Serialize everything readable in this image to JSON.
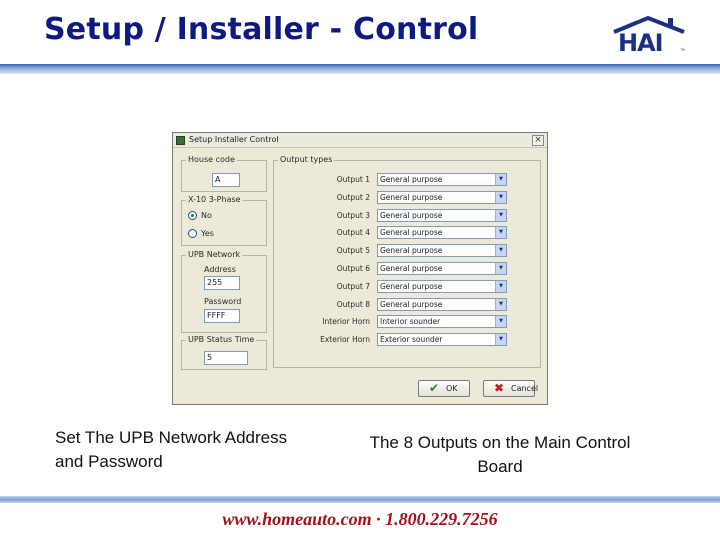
{
  "slide": {
    "title": "Setup / Installer - Control",
    "logo_text": "HAI",
    "logo_tm": "™",
    "caption_left": "Set The UPB Network Address and Password",
    "caption_right": "The 8 Outputs on the Main Control Board",
    "footer": "www.homeauto.com · 1.800.229.7256"
  },
  "dialog": {
    "title": "Setup Installer Control",
    "close_glyph": "×",
    "house_code": {
      "label": "House code",
      "value": "A"
    },
    "x10_phase": {
      "label": "X-10 3-Phase",
      "options": [
        {
          "label": "No",
          "selected": true
        },
        {
          "label": "Yes",
          "selected": false
        }
      ]
    },
    "upb_network": {
      "label": "UPB Network",
      "address_label": "Address",
      "address_value": "255",
      "password_label": "Password",
      "password_value": "FFFF"
    },
    "upb_status_time": {
      "label": "UPB Status Time",
      "value": "5"
    },
    "output_types": {
      "label": "Output types",
      "rows": [
        {
          "label": "Output 1",
          "value": "General purpose"
        },
        {
          "label": "Output 2",
          "value": "General purpose"
        },
        {
          "label": "Output 3",
          "value": "General purpose"
        },
        {
          "label": "Output 4",
          "value": "General purpose"
        },
        {
          "label": "Output 5",
          "value": "General purpose"
        },
        {
          "label": "Output 6",
          "value": "General purpose"
        },
        {
          "label": "Output 7",
          "value": "General purpose"
        },
        {
          "label": "Output 8",
          "value": "General purpose"
        },
        {
          "label": "Interior Horn",
          "value": "Interior sounder"
        },
        {
          "label": "Exterior Horn",
          "value": "Exterior sounder"
        }
      ]
    },
    "ok_label": "OK",
    "cancel_label": "Cancel",
    "ok_icon": "checkmark-icon",
    "cancel_icon": "x-icon",
    "dropdown_glyph": "▼"
  },
  "colors": {
    "title": "#0d1a80",
    "footer": "#a60f1a",
    "dialog_face": "#ece9d8",
    "ok_icon": "#1e8a1e",
    "cancel_icon": "#c21d1d"
  }
}
